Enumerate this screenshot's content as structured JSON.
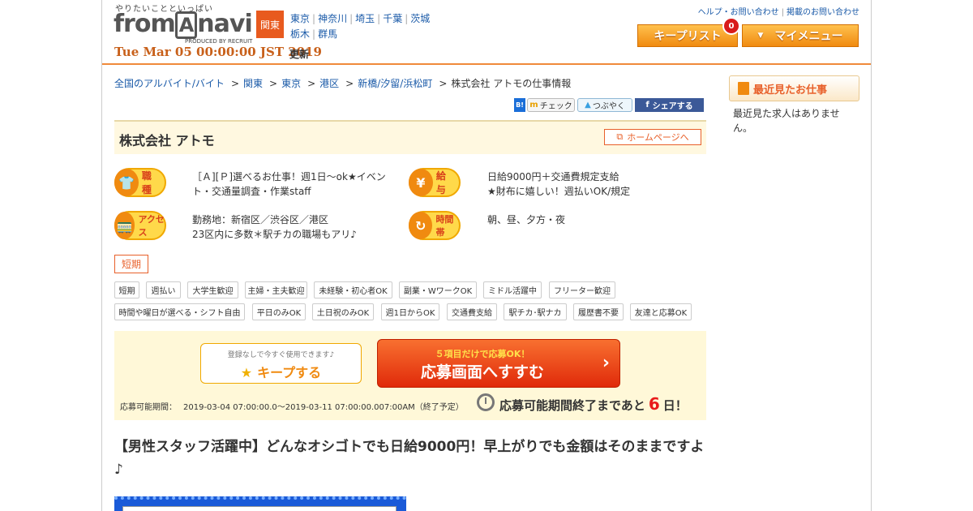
{
  "header": {
    "tagline": "やりたいことといっぱい",
    "logo": "fromAnavi",
    "produced_by": "PRODUCED BY RECRUIT",
    "datetime": "Tue Mar 05 00:00:00 JST 2019",
    "updated": "更新",
    "region": "関東",
    "prefectures": [
      "東京",
      "神奈川",
      "埼玉",
      "千葉",
      "茨城",
      "栃木",
      "群馬"
    ],
    "help_link": "ヘルプ・お問い合わせ",
    "ad_link": "掲載のお問い合わせ",
    "keep_list": "キープリスト",
    "keep_count": "0",
    "my_menu": "マイメニュー"
  },
  "breadcrumb": [
    "全国のアルバイト/バイト",
    "関東",
    "東京",
    "港区",
    "新橋/汐留/浜松町",
    "株式会社 アトモの仕事情報"
  ],
  "social": {
    "hatena": "B!",
    "check": "チェック",
    "tweet": "つぶやく",
    "share": "シェアする"
  },
  "company": {
    "name": "株式会社 アトモ",
    "homepage": "ホームページへ"
  },
  "info": {
    "job_label": "職種",
    "job": "［Ａ][Ｐ]選べるお仕事！週1日～ok★イベント・交通量調査・作業staff",
    "pay_label": "給与",
    "pay": "日給9000円＋交通費規定支給\n★財布に嬉しい！週払いOK/規定",
    "access_label": "アクセス",
    "access": "勤務地：新宿区／渋谷区／港区\n23区内に多数＊駅チカの職場もアリ♪",
    "time_label": "時間帯",
    "time": "朝、昼、夕方・夜"
  },
  "term_tag": "短期",
  "tags_row1": [
    "短期",
    "週払い",
    "大学生歓迎",
    "主婦・主夫歓迎",
    "未経験・初心者OK",
    "副業・WワークOK",
    "ミドル活躍中",
    "フリーター歓迎"
  ],
  "tags_row2": [
    "時間や曜日が選べる・シフト自由",
    "平日のみOK",
    "土日祝のみOK",
    "週1日からOK",
    "交通費支給",
    "駅チカ･駅ナカ",
    "履歴書不要",
    "友達と応募OK"
  ],
  "apply": {
    "keep_sub": "登録なしで今すぐ使用できます♪",
    "keep_main": "キープする",
    "apply_sub": "５項目だけで応募OK！",
    "apply_main": "応募画面へすすむ",
    "period_label": "応募可能期間：",
    "period": "2019-03-04 07:00:00.0～2019-03-11 07:00:00.007:00AM（終了予定）",
    "remaining_pre": "応募可能期間終了まであと",
    "remaining_days": "6",
    "remaining_post": "日！"
  },
  "catch": "【男性スタッフ活躍中】どんなオシゴトでも日給9000円！早上がりでも金額はそのままですよ♪",
  "sidebar": {
    "title": "最近見たお仕事",
    "empty": "最近見た求人はありません。"
  }
}
